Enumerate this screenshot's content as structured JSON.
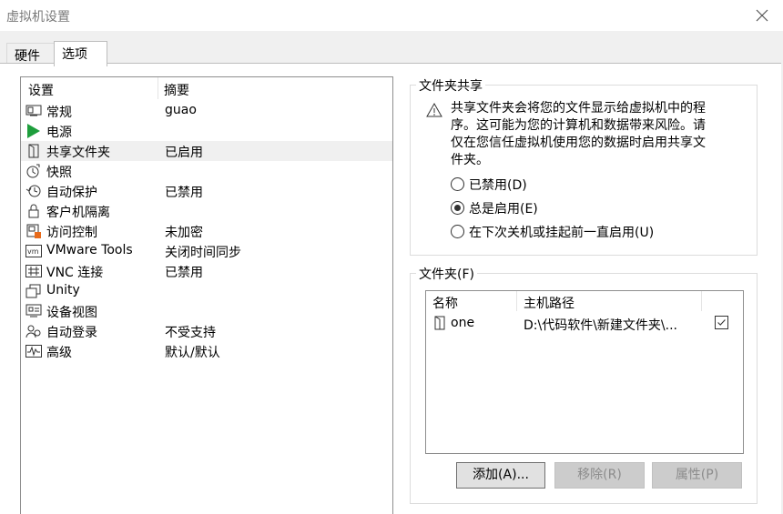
{
  "window": {
    "title": "虚拟机设置"
  },
  "tabs": [
    {
      "label": "硬件",
      "active": false
    },
    {
      "label": "选项",
      "active": true
    }
  ],
  "settings_list": {
    "headers": {
      "setting": "设置",
      "summary": "摘要"
    },
    "items": [
      {
        "name": "常规",
        "summary": "guao",
        "icon": "general-icon"
      },
      {
        "name": "电源",
        "summary": "",
        "icon": "power-play-icon"
      },
      {
        "name": "共享文件夹",
        "summary": "已启用",
        "icon": "shared-folder-icon",
        "selected": true
      },
      {
        "name": "快照",
        "summary": "",
        "icon": "snapshot-icon"
      },
      {
        "name": "自动保护",
        "summary": "已禁用",
        "icon": "autoprotect-icon"
      },
      {
        "name": "客户机隔离",
        "summary": "",
        "icon": "lock-icon"
      },
      {
        "name": "访问控制",
        "summary": "未加密",
        "icon": "access-control-icon"
      },
      {
        "name": "VMware Tools",
        "summary": "关闭时间同步",
        "icon": "vmware-tools-icon"
      },
      {
        "name": "VNC 连接",
        "summary": "已禁用",
        "icon": "vnc-icon"
      },
      {
        "name": "Unity",
        "summary": "",
        "icon": "unity-icon"
      },
      {
        "name": "设备视图",
        "summary": "",
        "icon": "device-view-icon"
      },
      {
        "name": "自动登录",
        "summary": "不受支持",
        "icon": "autologin-icon"
      },
      {
        "name": "高级",
        "summary": "默认/默认",
        "icon": "advanced-icon"
      }
    ]
  },
  "folder_sharing": {
    "title": "文件夹共享",
    "warning": "共享文件夹会将您的文件显示给虚拟机中的程序。这可能为您的计算机和数据带来风险。请仅在您信任虚拟机使用您的数据时启用共享文件夹。",
    "options": [
      {
        "label": "已禁用(D)",
        "checked": false
      },
      {
        "label": "总是启用(E)",
        "checked": true
      },
      {
        "label": "在下次关机或挂起前一直启用(U)",
        "checked": false
      }
    ]
  },
  "folders": {
    "title": "文件夹(F)",
    "headers": {
      "name": "名称",
      "host_path": "主机路径"
    },
    "rows": [
      {
        "name": "one",
        "host_path": "D:\\代码软件\\新建文件夹\\...",
        "enabled": true
      }
    ],
    "buttons": {
      "add": "添加(A)...",
      "remove": "移除(R)",
      "properties": "属性(P)"
    }
  }
}
